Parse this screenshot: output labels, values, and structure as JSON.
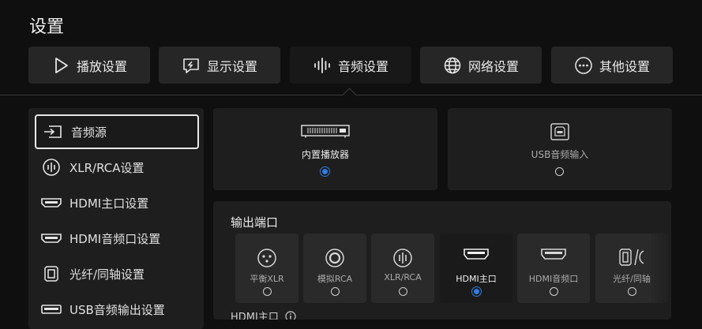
{
  "page": {
    "title": "设置"
  },
  "tabs": [
    {
      "label": "播放设置",
      "icon": "play-icon"
    },
    {
      "label": "显示设置",
      "icon": "display-icon"
    },
    {
      "label": "音频设置",
      "icon": "audio-wave-icon",
      "active": true
    },
    {
      "label": "网络设置",
      "icon": "globe-icon"
    },
    {
      "label": "其他设置",
      "icon": "more-icon"
    }
  ],
  "sidebar": {
    "items": [
      {
        "label": "音频源",
        "icon": "input-source-icon",
        "active": true
      },
      {
        "label": "XLR/RCA设置",
        "icon": "xlr-icon"
      },
      {
        "label": "HDMI主口设置",
        "icon": "hdmi-icon"
      },
      {
        "label": "HDMI音频口设置",
        "icon": "hdmi-icon"
      },
      {
        "label": "光纤/同轴设置",
        "icon": "optical-icon"
      },
      {
        "label": "USB音频输出设置",
        "icon": "usb-icon"
      }
    ]
  },
  "sources": [
    {
      "label": "内置播放器",
      "icon": "player-device-icon",
      "selected": true
    },
    {
      "label": "USB音频输入",
      "icon": "usb-b-icon",
      "selected": false
    }
  ],
  "output": {
    "heading": "输出端口",
    "ports": [
      {
        "label": "平衡XLR",
        "icon": "xlr-connector-icon",
        "selected": false
      },
      {
        "label": "模拟RCA",
        "icon": "rca-connector-icon",
        "selected": false
      },
      {
        "label": "XLR/RCA",
        "icon": "xlr-rca-icon",
        "selected": false
      },
      {
        "label": "HDMI主口",
        "icon": "hdmi-port-icon",
        "selected": true
      },
      {
        "label": "HDMI音频口",
        "icon": "hdmi-port-icon",
        "selected": false
      },
      {
        "label": "光纤/同轴",
        "icon": "optical-coax-icon",
        "selected": false
      }
    ],
    "sub_heading": "HDMI主口"
  },
  "colors": {
    "accent": "#2f7de1",
    "background": "#0f0f0f",
    "panel": "#1e1e1e"
  }
}
